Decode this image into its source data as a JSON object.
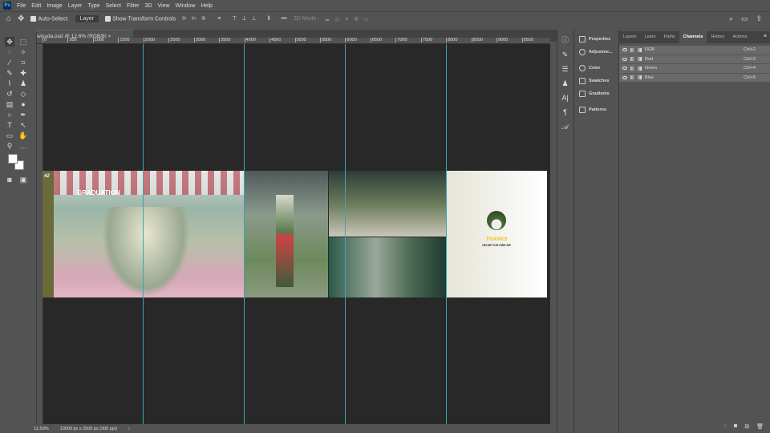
{
  "menu": [
    "File",
    "Edit",
    "Image",
    "Layer",
    "Type",
    "Select",
    "Filter",
    "3D",
    "View",
    "Window",
    "Help"
  ],
  "options": {
    "auto_select": "Auto-Select:",
    "layer": "Layer",
    "show_transform": "Show Transform Controls",
    "mode3d": "3D Mode:"
  },
  "document": {
    "tab": "wisuda.psd @ 12,6% (RGB/8)"
  },
  "ruler": [
    "0",
    "500",
    "1000",
    "1500",
    "2000",
    "2500",
    "3000",
    "3500",
    "4000",
    "4500",
    "5000",
    "5500",
    "6000",
    "6500",
    "7000",
    "7500",
    "8000",
    "8500",
    "9000",
    "9500"
  ],
  "status": {
    "zoom": "12,59%",
    "size": "10000 px x 2500 px (300 ppi)"
  },
  "dock": [
    "Properties",
    "Adjustme...",
    "Color",
    "Swatches",
    "Gradients",
    "Patterns"
  ],
  "panel_tabs": [
    "Layers",
    "Learn",
    "Paths",
    "Channels",
    "History",
    "Actions"
  ],
  "channels": [
    {
      "name": "RGB",
      "shortcut": "Ctrl+2"
    },
    {
      "name": "Red",
      "shortcut": "Ctrl+3"
    },
    {
      "name": "Green",
      "shortcut": "Ctrl+4"
    },
    {
      "name": "Blue",
      "shortcut": "Ctrl+5"
    }
  ],
  "artwork": {
    "number": "#2",
    "title": "GRADUATION",
    "thanks": "THANKS",
    "subtitle": "DM ME FOR HIRE ME"
  }
}
